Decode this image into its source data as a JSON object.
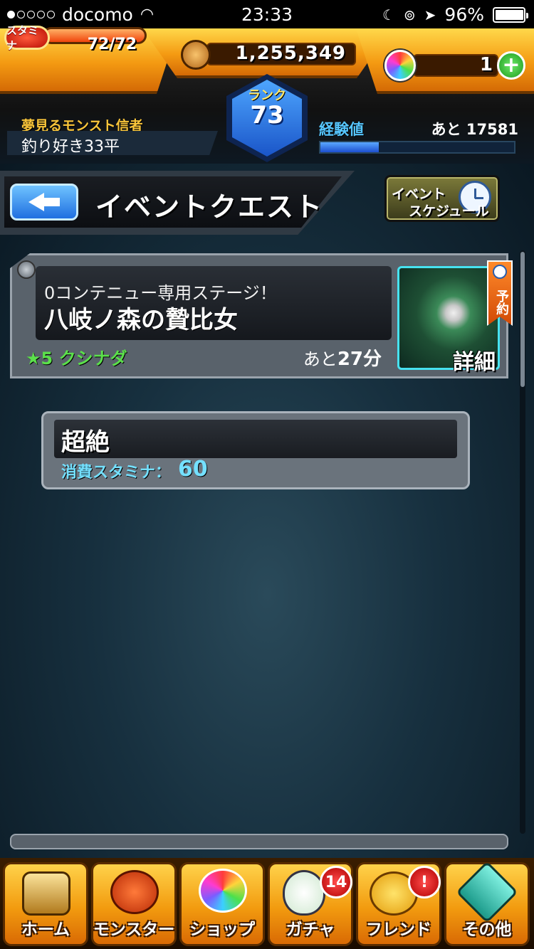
{
  "status_bar": {
    "carrier": "docomo",
    "time": "23:33",
    "battery": "96%"
  },
  "header": {
    "stamina_label": "スタミナ",
    "stamina": "72/72",
    "stamina_fraction": 1.0,
    "gold": "1,255,349",
    "orb_count": "1",
    "rank_label": "ランク",
    "rank": "73",
    "player_title": "夢見るモンスト信者",
    "player_name": "釣り好き33平",
    "exp_label": "経験値",
    "exp_remaining": "あと 17581",
    "exp_fraction": 0.3
  },
  "page": {
    "title": "イベントクエスト",
    "schedule_line1": "イベント",
    "schedule_line2": "スケジュール"
  },
  "quest": {
    "subtitle": "0コンテニュー専用ステージ！",
    "name": "八岐ノ森の贄比女",
    "difficulty": "★5 クシナダ",
    "time_prefix": "あと",
    "time_value": "27分",
    "ribbon": "予約",
    "detail": "詳細"
  },
  "difficulty_option": {
    "title": "超絶",
    "stamina_label": "消費スタミナ：",
    "stamina_value": "60"
  },
  "tabs": [
    {
      "label": "ホーム"
    },
    {
      "label": "モンスター"
    },
    {
      "label": "ショップ"
    },
    {
      "label": "ガチャ",
      "badge": "14"
    },
    {
      "label": "フレンド",
      "badge": "!"
    },
    {
      "label": "その他"
    }
  ],
  "colors": {
    "orange": "#f49a12",
    "blue": "#1f6fe0",
    "green": "#5be04b",
    "cyan": "#74e0ff"
  }
}
